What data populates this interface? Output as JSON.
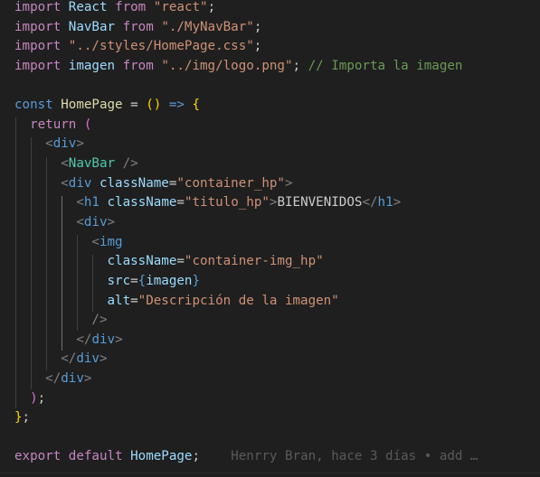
{
  "editor": {
    "lines": {
      "l1": {
        "k_import": "import",
        "id_react": "React",
        "k_from": "from",
        "s_react": "\"react\"",
        "semi": ";"
      },
      "l2": {
        "k_import": "import",
        "id_navbar": "NavBar",
        "k_from": "from",
        "s_path": "\"./MyNavBar\"",
        "semi": ";"
      },
      "l3": {
        "k_import": "import",
        "s_css": "\"../styles/HomePage.css\"",
        "semi": ";"
      },
      "l4": {
        "k_import": "import",
        "id_imagen": "imagen",
        "k_from": "from",
        "s_logo": "\"../img/logo.png\"",
        "semi": ";",
        "comment": "// Importa la imagen"
      },
      "l6": {
        "k_const": "const",
        "id_homepage": "HomePage",
        "eq": "=",
        "paren": "()",
        "arrow": "=>",
        "brace": "{"
      },
      "l7": {
        "k_return": "return",
        "paren": "("
      },
      "l8": {
        "lt": "<",
        "tag": "div",
        "gt": ">"
      },
      "l9": {
        "lt": "<",
        "tag": "NavBar",
        "close": "/>"
      },
      "l10": {
        "lt": "<",
        "tag": "div",
        "attr": "className",
        "eq": "=",
        "val": "\"container_hp\"",
        "gt": ">"
      },
      "l11": {
        "lt": "<",
        "tag": "h1",
        "attr": "className",
        "eq": "=",
        "val": "\"titulo_hp\"",
        "gt": ">",
        "text": "BIENVENIDOS",
        "lt2": "</",
        "tag2": "h1",
        "gt2": ">"
      },
      "l12": {
        "lt": "<",
        "tag": "div",
        "gt": ">"
      },
      "l13": {
        "lt": "<",
        "tag": "img"
      },
      "l14": {
        "attr": "className",
        "eq": "=",
        "val": "\"container-img_hp\""
      },
      "l15": {
        "attr": "src",
        "eq": "=",
        "ob": "{",
        "var": "imagen",
        "cb": "}"
      },
      "l16": {
        "attr": "alt",
        "eq": "=",
        "val": "\"Descripción de la imagen\""
      },
      "l17": {
        "close": "/>"
      },
      "l18": {
        "lt": "</",
        "tag": "div",
        "gt": ">"
      },
      "l19": {
        "lt": "</",
        "tag": "div",
        "gt": ">"
      },
      "l20": {
        "lt": "</",
        "tag": "div",
        "gt": ">"
      },
      "l21": {
        "paren": ")",
        "semi": ";"
      },
      "l22": {
        "brace": "}",
        "semi": ";"
      },
      "l24": {
        "k_export": "export",
        "k_default": "default",
        "id_homepage": "HomePage",
        "semi": ";"
      }
    },
    "blame": "Henrry Bran, hace 3 días • add …"
  },
  "colors": {
    "background": "#1f1f1f",
    "keyword_control": "#c586c0",
    "keyword": "#569cd6",
    "string": "#ce9178",
    "variable": "#9cdcfe",
    "function": "#dcdcaa",
    "comment": "#6a9955",
    "component": "#4ec9b0",
    "bracket_1": "#ffd700",
    "bracket_2": "#da70d6",
    "bracket_3": "#179fff"
  }
}
